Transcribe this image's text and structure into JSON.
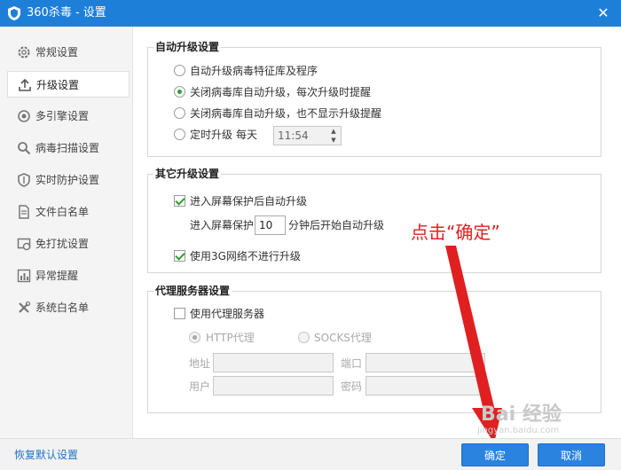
{
  "window": {
    "title": "360杀毒 - 设置",
    "close_glyph": "✕",
    "accent_color": "#1e7fd8"
  },
  "sidebar": {
    "items": [
      {
        "label": "常规设置",
        "icon": "gear-icon"
      },
      {
        "label": "升级设置",
        "icon": "upload-icon",
        "active": true
      },
      {
        "label": "多引擎设置",
        "icon": "engine-icon"
      },
      {
        "label": "病毒扫描设置",
        "icon": "search-icon"
      },
      {
        "label": "实时防护设置",
        "icon": "shield-icon"
      },
      {
        "label": "文件白名单",
        "icon": "file-icon"
      },
      {
        "label": "免打扰设置",
        "icon": "do-not-disturb-icon"
      },
      {
        "label": "异常提醒",
        "icon": "bar-chart-icon"
      },
      {
        "label": "系统白名单",
        "icon": "tools-icon"
      }
    ]
  },
  "auto_upgrade": {
    "title": "自动升级设置",
    "options": [
      "自动升级病毒特征库及程序",
      "关闭病毒库自动升级，每次升级时提醒",
      "关闭病毒库自动升级，也不显示升级提醒",
      "定时升级"
    ],
    "selected_index": 1,
    "schedule_label": "每天",
    "schedule_time": "11:54"
  },
  "other_upgrade": {
    "title": "其它升级设置",
    "screensaver_label": "进入屏幕保护后自动升级",
    "screensaver_checked": true,
    "delay_prefix": "进入屏幕保护",
    "delay_value": "10",
    "delay_suffix": "分钟后开始自动升级",
    "no_3g_label": "使用3G网络不进行升级",
    "no_3g_checked": true
  },
  "proxy": {
    "title": "代理服务器设置",
    "use_proxy_label": "使用代理服务器",
    "use_proxy_checked": false,
    "http_label": "HTTP代理",
    "socks_label": "SOCKS代理",
    "address_label": "地址",
    "port_label": "端口",
    "user_label": "用户",
    "password_label": "密码",
    "address_value": "",
    "port_value": "",
    "user_value": "",
    "password_value": ""
  },
  "annotation": {
    "text": "点击“确定”",
    "color": "#e02020"
  },
  "footer": {
    "restore_label": "恢复默认设置",
    "ok_label": "确定",
    "cancel_label": "取消"
  },
  "watermark": {
    "logo_text": "Bai 经验",
    "url_text": "jingyan.baidu.com"
  }
}
